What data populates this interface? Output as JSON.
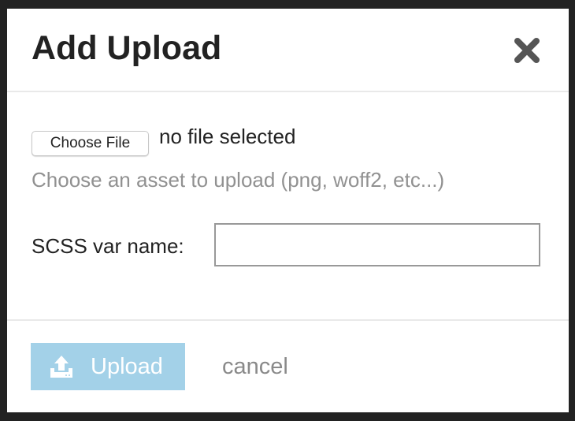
{
  "modal": {
    "title": "Add Upload",
    "close_icon": "close-icon",
    "file_input": {
      "button_label": "Choose File",
      "status": "no file selected"
    },
    "hint": "Choose an asset to upload (png, woff2, etc...)",
    "var_name": {
      "label": "SCSS var name:",
      "value": ""
    },
    "footer": {
      "upload_label": "Upload",
      "upload_icon": "upload-icon",
      "cancel_label": "cancel"
    }
  },
  "colors": {
    "upload_button_bg": "#a3d1e8",
    "overlay": "#222222"
  }
}
